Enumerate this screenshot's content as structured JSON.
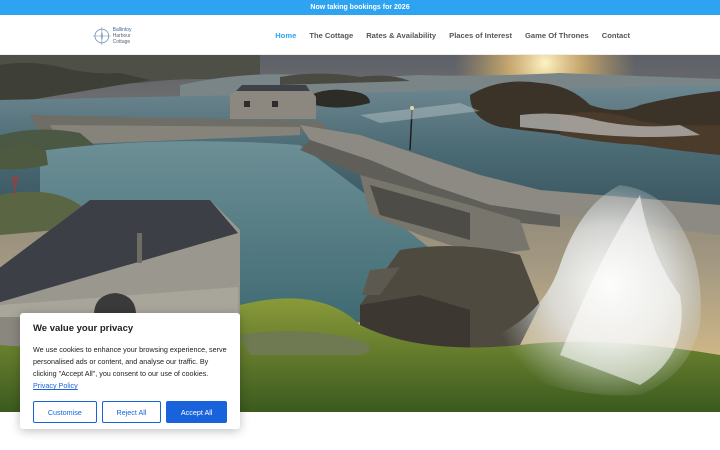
{
  "announcement": "Now taking bookings for 2026",
  "logo": {
    "line1": "Ballintoy",
    "line2": "Harbour Cottage"
  },
  "nav": [
    {
      "label": "Home"
    },
    {
      "label": "The Cottage"
    },
    {
      "label": "Rates & Availability"
    },
    {
      "label": "Places of Interest"
    },
    {
      "label": "Game Of Thrones"
    },
    {
      "label": "Contact"
    }
  ],
  "cookie": {
    "title": "We value your privacy",
    "body": "We use cookies to enhance your browsing experience, serve personalised ads or content, and analyse our traffic. By clicking \"Accept All\", you consent to our use of cookies.",
    "policy_link": "Privacy Policy",
    "customise": "Customise",
    "reject": "Reject All",
    "accept": "Accept All"
  },
  "colors": {
    "accent": "#2ea3f2",
    "cookie_button": "#1863dc"
  }
}
